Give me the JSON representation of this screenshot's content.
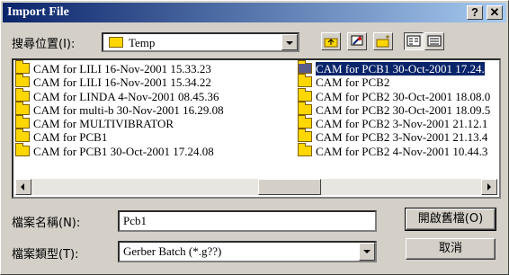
{
  "window": {
    "title": "Import File",
    "help_label": "?",
    "close_label": "✕"
  },
  "lookin": {
    "label": "搜尋位置(I):",
    "value": "Temp"
  },
  "toolbar": {
    "icons": [
      "up-folder-icon",
      "desktop-icon",
      "new-folder-icon",
      "list-view-icon",
      "details-view-icon"
    ]
  },
  "files": {
    "left": [
      "CAM for LILI 16-Nov-2001 15.33.23",
      "CAM for LILI 16-Nov-2001 15.34.22",
      "CAM for LINDA 4-Nov-2001 08.45.36",
      "CAM for multi-b 30-Nov-2001 16.29.08",
      "CAM for MULTIVIBRATOR",
      "CAM for PCB1",
      "CAM for PCB1 30-Oct-2001 17.24.08"
    ],
    "right": [
      "CAM for PCB1 30-Oct-2001 17.24.",
      "CAM for PCB2",
      "CAM for PCB2 30-Oct-2001 18.08.0",
      "CAM for PCB2 30-Oct-2001 18.09.5",
      "CAM for PCB2 3-Nov-2001 21.12.1",
      "CAM for PCB2 3-Nov-2001 21.13.4",
      "CAM for PCB2 4-Nov-2001 10.44.3"
    ],
    "selected": "CAM for PCB1 30-Oct-2001 17.24."
  },
  "filename": {
    "label": "檔案名稱(N):",
    "value": "Pcb1"
  },
  "filetype": {
    "label": "檔案類型(T):",
    "value": "Gerber Batch (*.g??)"
  },
  "buttons": {
    "open": "開啟舊檔(O)",
    "cancel": "取消"
  },
  "colors": {
    "titlebar": "#0a246a",
    "face": "#d4d0c8",
    "selection": "#0a246a",
    "folder": "#ffd700"
  }
}
